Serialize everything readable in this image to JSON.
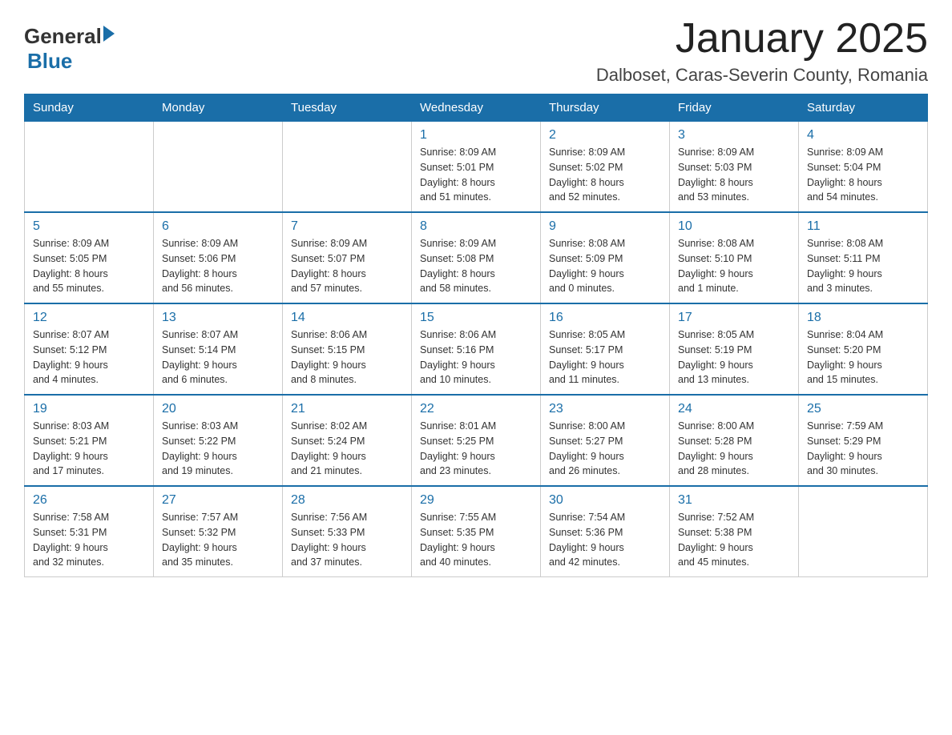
{
  "logo": {
    "general": "General",
    "blue": "Blue"
  },
  "title": "January 2025",
  "location": "Dalboset, Caras-Severin County, Romania",
  "headers": [
    "Sunday",
    "Monday",
    "Tuesday",
    "Wednesday",
    "Thursday",
    "Friday",
    "Saturday"
  ],
  "weeks": [
    [
      {
        "day": "",
        "info": ""
      },
      {
        "day": "",
        "info": ""
      },
      {
        "day": "",
        "info": ""
      },
      {
        "day": "1",
        "info": "Sunrise: 8:09 AM\nSunset: 5:01 PM\nDaylight: 8 hours\nand 51 minutes."
      },
      {
        "day": "2",
        "info": "Sunrise: 8:09 AM\nSunset: 5:02 PM\nDaylight: 8 hours\nand 52 minutes."
      },
      {
        "day": "3",
        "info": "Sunrise: 8:09 AM\nSunset: 5:03 PM\nDaylight: 8 hours\nand 53 minutes."
      },
      {
        "day": "4",
        "info": "Sunrise: 8:09 AM\nSunset: 5:04 PM\nDaylight: 8 hours\nand 54 minutes."
      }
    ],
    [
      {
        "day": "5",
        "info": "Sunrise: 8:09 AM\nSunset: 5:05 PM\nDaylight: 8 hours\nand 55 minutes."
      },
      {
        "day": "6",
        "info": "Sunrise: 8:09 AM\nSunset: 5:06 PM\nDaylight: 8 hours\nand 56 minutes."
      },
      {
        "day": "7",
        "info": "Sunrise: 8:09 AM\nSunset: 5:07 PM\nDaylight: 8 hours\nand 57 minutes."
      },
      {
        "day": "8",
        "info": "Sunrise: 8:09 AM\nSunset: 5:08 PM\nDaylight: 8 hours\nand 58 minutes."
      },
      {
        "day": "9",
        "info": "Sunrise: 8:08 AM\nSunset: 5:09 PM\nDaylight: 9 hours\nand 0 minutes."
      },
      {
        "day": "10",
        "info": "Sunrise: 8:08 AM\nSunset: 5:10 PM\nDaylight: 9 hours\nand 1 minute."
      },
      {
        "day": "11",
        "info": "Sunrise: 8:08 AM\nSunset: 5:11 PM\nDaylight: 9 hours\nand 3 minutes."
      }
    ],
    [
      {
        "day": "12",
        "info": "Sunrise: 8:07 AM\nSunset: 5:12 PM\nDaylight: 9 hours\nand 4 minutes."
      },
      {
        "day": "13",
        "info": "Sunrise: 8:07 AM\nSunset: 5:14 PM\nDaylight: 9 hours\nand 6 minutes."
      },
      {
        "day": "14",
        "info": "Sunrise: 8:06 AM\nSunset: 5:15 PM\nDaylight: 9 hours\nand 8 minutes."
      },
      {
        "day": "15",
        "info": "Sunrise: 8:06 AM\nSunset: 5:16 PM\nDaylight: 9 hours\nand 10 minutes."
      },
      {
        "day": "16",
        "info": "Sunrise: 8:05 AM\nSunset: 5:17 PM\nDaylight: 9 hours\nand 11 minutes."
      },
      {
        "day": "17",
        "info": "Sunrise: 8:05 AM\nSunset: 5:19 PM\nDaylight: 9 hours\nand 13 minutes."
      },
      {
        "day": "18",
        "info": "Sunrise: 8:04 AM\nSunset: 5:20 PM\nDaylight: 9 hours\nand 15 minutes."
      }
    ],
    [
      {
        "day": "19",
        "info": "Sunrise: 8:03 AM\nSunset: 5:21 PM\nDaylight: 9 hours\nand 17 minutes."
      },
      {
        "day": "20",
        "info": "Sunrise: 8:03 AM\nSunset: 5:22 PM\nDaylight: 9 hours\nand 19 minutes."
      },
      {
        "day": "21",
        "info": "Sunrise: 8:02 AM\nSunset: 5:24 PM\nDaylight: 9 hours\nand 21 minutes."
      },
      {
        "day": "22",
        "info": "Sunrise: 8:01 AM\nSunset: 5:25 PM\nDaylight: 9 hours\nand 23 minutes."
      },
      {
        "day": "23",
        "info": "Sunrise: 8:00 AM\nSunset: 5:27 PM\nDaylight: 9 hours\nand 26 minutes."
      },
      {
        "day": "24",
        "info": "Sunrise: 8:00 AM\nSunset: 5:28 PM\nDaylight: 9 hours\nand 28 minutes."
      },
      {
        "day": "25",
        "info": "Sunrise: 7:59 AM\nSunset: 5:29 PM\nDaylight: 9 hours\nand 30 minutes."
      }
    ],
    [
      {
        "day": "26",
        "info": "Sunrise: 7:58 AM\nSunset: 5:31 PM\nDaylight: 9 hours\nand 32 minutes."
      },
      {
        "day": "27",
        "info": "Sunrise: 7:57 AM\nSunset: 5:32 PM\nDaylight: 9 hours\nand 35 minutes."
      },
      {
        "day": "28",
        "info": "Sunrise: 7:56 AM\nSunset: 5:33 PM\nDaylight: 9 hours\nand 37 minutes."
      },
      {
        "day": "29",
        "info": "Sunrise: 7:55 AM\nSunset: 5:35 PM\nDaylight: 9 hours\nand 40 minutes."
      },
      {
        "day": "30",
        "info": "Sunrise: 7:54 AM\nSunset: 5:36 PM\nDaylight: 9 hours\nand 42 minutes."
      },
      {
        "day": "31",
        "info": "Sunrise: 7:52 AM\nSunset: 5:38 PM\nDaylight: 9 hours\nand 45 minutes."
      },
      {
        "day": "",
        "info": ""
      }
    ]
  ]
}
